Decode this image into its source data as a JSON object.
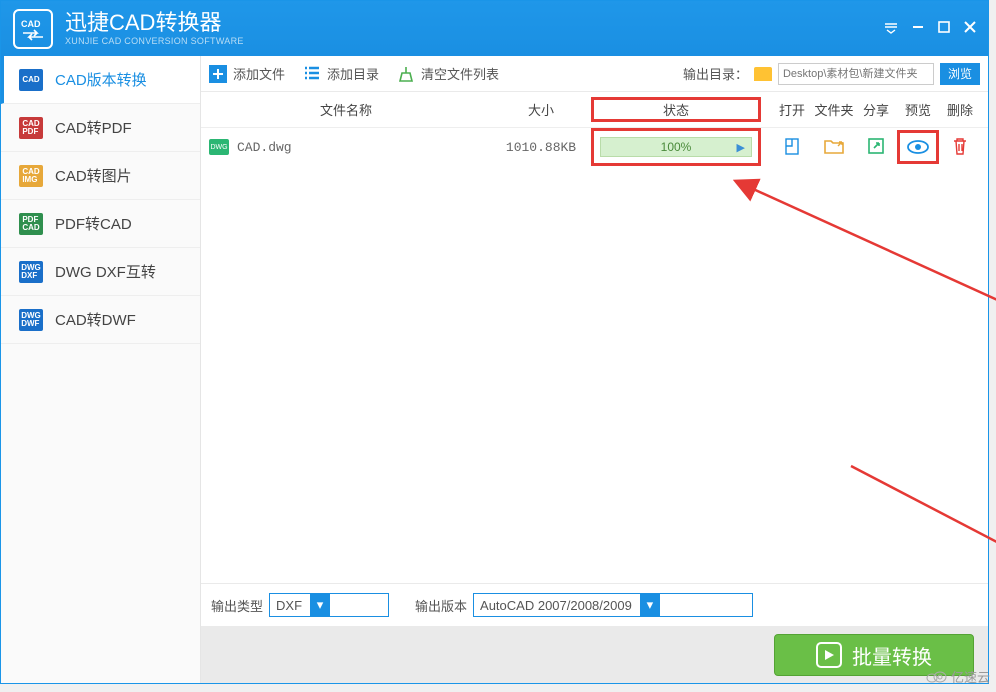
{
  "app": {
    "title": "迅捷CAD转换器",
    "subtitle": "XUNJIE CAD CONVERSION SOFTWARE"
  },
  "sidebar": {
    "items": [
      {
        "label": "CAD版本转换",
        "icon_bg": "#1a6fc9",
        "icon_text": "CAD"
      },
      {
        "label": "CAD转PDF",
        "icon_bg": "#c73a3a",
        "icon_text": "CAD\nPDF"
      },
      {
        "label": "CAD转图片",
        "icon_bg": "#e7a83a",
        "icon_text": "CAD\nIMG"
      },
      {
        "label": "PDF转CAD",
        "icon_bg": "#2f8f4e",
        "icon_text": "PDF\nCAD"
      },
      {
        "label": "DWG DXF互转",
        "icon_bg": "#1a6fc9",
        "icon_text": "DWG\nDXF"
      },
      {
        "label": "CAD转DWF",
        "icon_bg": "#1a6fc9",
        "icon_text": "DWG\nDWF"
      }
    ]
  },
  "toolbar": {
    "add_file": "添加文件",
    "add_dir": "添加目录",
    "clear_list": "清空文件列表",
    "output_dir_label": "输出目录：",
    "path_placeholder": "Desktop\\素材包\\新建文件夹",
    "browse": "浏览"
  },
  "table": {
    "headers": {
      "name": "文件名称",
      "size": "大小",
      "status": "状态",
      "open": "打开",
      "folder": "文件夹",
      "share": "分享",
      "preview": "预览",
      "delete": "删除"
    },
    "rows": [
      {
        "icon": "DWG",
        "name": "CAD.dwg",
        "size": "1010.88KB",
        "progress": "100%"
      }
    ]
  },
  "output": {
    "type_label": "输出类型",
    "type_value": "DXF",
    "version_label": "输出版本",
    "version_value": "AutoCAD 2007/2008/2009"
  },
  "footer": {
    "convert": "批量转换"
  },
  "watermark": "亿速云"
}
